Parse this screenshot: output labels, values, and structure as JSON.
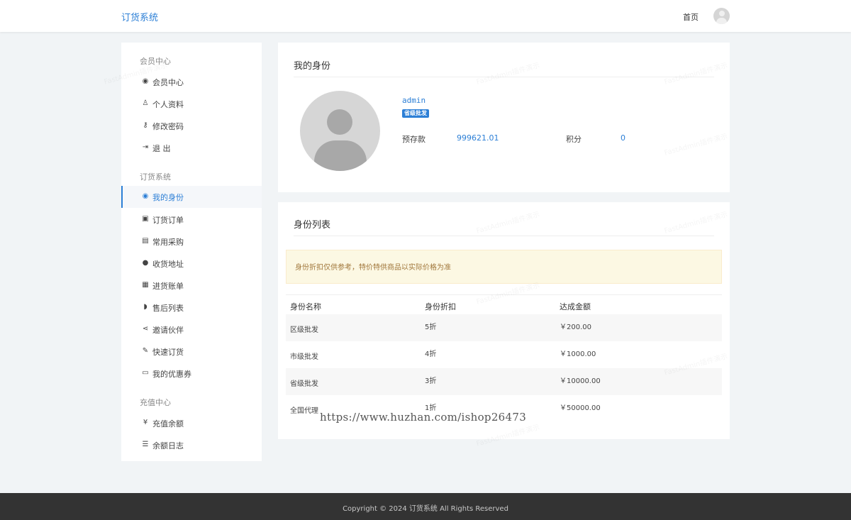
{
  "navbar": {
    "brand": "订货系统",
    "home_link": "首页"
  },
  "sidebar": {
    "sections": [
      {
        "heading": "会员中心",
        "items": [
          {
            "icon": "user-circle-icon",
            "label": "会员中心"
          },
          {
            "icon": "user-icon",
            "label": "个人资料"
          },
          {
            "icon": "key-icon",
            "label": "修改密码"
          },
          {
            "icon": "sign-out-icon",
            "label": "退 出"
          }
        ]
      },
      {
        "heading": "订货系统",
        "items": [
          {
            "icon": "user-circle-icon",
            "label": "我的身份",
            "active": true
          },
          {
            "icon": "shopping-bag-icon",
            "label": "订货订单"
          },
          {
            "icon": "file-text-icon",
            "label": "常用采购"
          },
          {
            "icon": "map-marker-icon",
            "label": "收货地址"
          },
          {
            "icon": "calendar-icon",
            "label": "进货账单"
          },
          {
            "icon": "comments-icon",
            "label": "售后列表"
          },
          {
            "icon": "share-icon",
            "label": "邀请伙伴"
          },
          {
            "icon": "edit-icon",
            "label": "快速订货"
          },
          {
            "icon": "money-icon",
            "label": "我的优惠券"
          }
        ]
      },
      {
        "heading": "充值中心",
        "items": [
          {
            "icon": "yen-icon",
            "label": "充值余额"
          },
          {
            "icon": "list-icon",
            "label": "余额日志"
          }
        ]
      }
    ]
  },
  "identity": {
    "title": "我的身份",
    "username": "admin",
    "level": "省级批发",
    "deposit_label": "预存款",
    "deposit_value": "999621.01",
    "points_label": "积分",
    "points_value": "0"
  },
  "identity_list": {
    "title": "身份列表",
    "notice": "身份折扣仅供参考，特价特供商品以实际价格为准",
    "columns": [
      "身份名称",
      "身份折扣",
      "达成金额"
    ],
    "rows": [
      [
        "区级批发",
        "5折",
        "￥200.00"
      ],
      [
        "市级批发",
        "4折",
        "￥1000.00"
      ],
      [
        "省级批发",
        "3折",
        "￥10000.00"
      ],
      [
        "全国代理",
        "1折",
        "￥50000.00"
      ]
    ]
  },
  "footer": {
    "copyright": "Copyright © 2024 订货系统 All Rights Reserved"
  },
  "overlay_text": "https://www.huzhan.com/ishop26473",
  "watermark_text": "FastAdmin插件演示",
  "colors": {
    "accent": "#2c7fd6",
    "footer_bg": "#333333",
    "alert_bg": "#fcf8e3",
    "alert_text": "#a0763a"
  }
}
